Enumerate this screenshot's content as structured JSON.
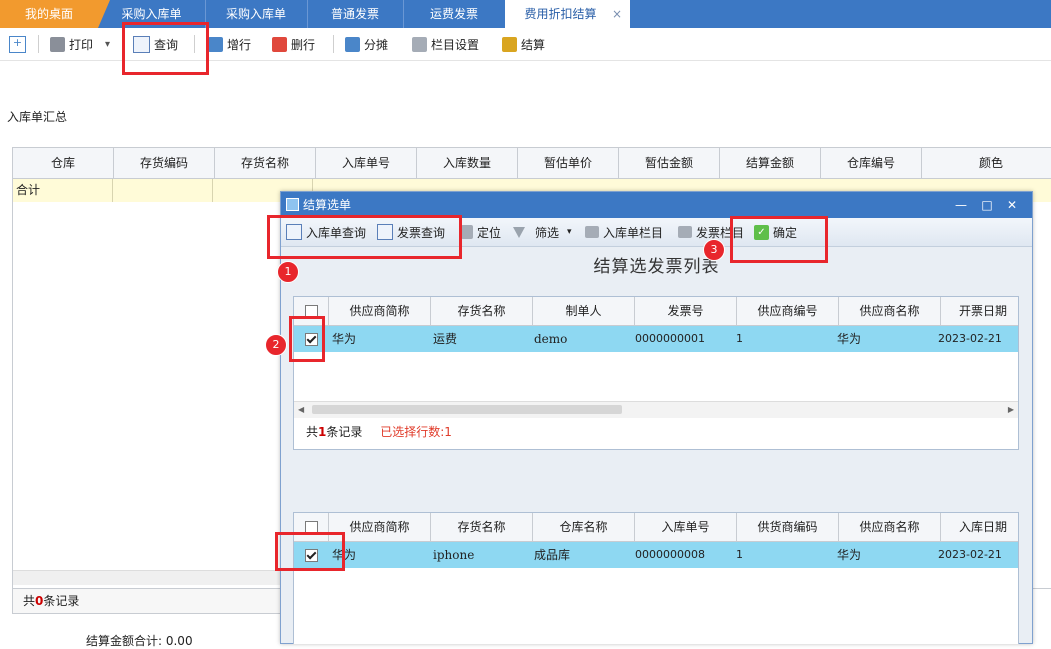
{
  "tabs": [
    {
      "label": "我的桌面"
    },
    {
      "label": "采购入库单"
    },
    {
      "label": "采购入库单"
    },
    {
      "label": "普通发票"
    },
    {
      "label": "运费发票"
    },
    {
      "label": "费用折扣结算",
      "close": "×"
    }
  ],
  "toolbar": {
    "print": "打印",
    "print_arrow": "▾",
    "query": "查询",
    "add_row": "增行",
    "delete_row": "删行",
    "split": "分摊",
    "column_settings": "栏目设置",
    "settle": "结算"
  },
  "section_title": "入库单汇总",
  "main_grid": {
    "columns": [
      "仓库",
      "存货编码",
      "存货名称",
      "入库单号",
      "入库数量",
      "暂估单价",
      "暂估金额",
      "结算金额",
      "仓库编号",
      "颜色"
    ],
    "summary_label": "合计",
    "footer": {
      "prefix": "共",
      "count": "0",
      "suffix": "条记录"
    },
    "bottom_text": "结算金额合计: 0.00"
  },
  "dialog": {
    "title": "结算选单",
    "controls": {
      "minimize": "—",
      "maximize": "□",
      "close": "✕"
    },
    "toolbar": {
      "receipt_query": "入库单查询",
      "invoice_query": "发票查询",
      "locate": "定位",
      "filter": "筛选",
      "filter_arrow": "▾",
      "receipt_columns": "入库单栏目",
      "invoice_columns": "发票栏目",
      "confirm": "确定"
    },
    "heading": "结算选发票列表",
    "invoice_grid": {
      "columns": [
        "供应商简称",
        "存货名称",
        "制单人",
        "发票号",
        "供应商编号",
        "供应商名称",
        "开票日期"
      ],
      "rows": [
        {
          "checked": true,
          "cells": [
            "华为",
            "运费",
            "demo",
            "0000000001",
            "1",
            "华为",
            "2023-02-21"
          ]
        }
      ],
      "footer": {
        "prefix": "共",
        "count": "1",
        "suffix": "条记录",
        "selected": "已选择行数:1"
      }
    },
    "receipt_grid": {
      "columns": [
        "供应商简称",
        "存货名称",
        "仓库名称",
        "入库单号",
        "供货商编码",
        "供应商名称",
        "入库日期"
      ],
      "rows": [
        {
          "checked": true,
          "cells": [
            "华为",
            "iphone",
            "成品库",
            "0000000008",
            "1",
            "华为",
            "2023-02-21"
          ]
        }
      ]
    }
  },
  "annotations": {
    "badge1": "1",
    "badge2": "2",
    "badge3": "3",
    "color": "#e8262c"
  },
  "colors": {
    "titlebar": "#3c78c4",
    "home_tab": "#f29a2e",
    "selected_row": "#8ed8f2",
    "summary_row": "#fffbd8"
  }
}
